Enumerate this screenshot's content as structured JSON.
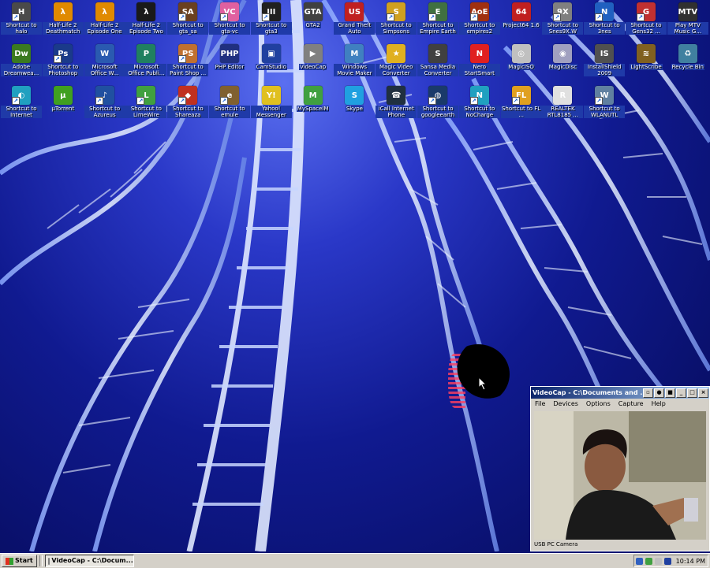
{
  "desktop": {
    "icons": [
      {
        "label": "Shortcut to halo",
        "icon": "halo-icon",
        "color": "#4a4a4a",
        "glyph": "H",
        "shortcut": true
      },
      {
        "label": "Half-Life 2 Deathmatch",
        "icon": "half-life-icon",
        "color": "#e08a00",
        "glyph": "λ",
        "shortcut": false
      },
      {
        "label": "Half-Life 2 Episode One",
        "icon": "half-life-icon",
        "color": "#e08a00",
        "glyph": "λ",
        "shortcut": false
      },
      {
        "label": "Half-Life 2 Episode Two",
        "icon": "half-life-icon",
        "color": "#1a1a1a",
        "glyph": "λ",
        "shortcut": false
      },
      {
        "label": "Shortcut to gta_sa",
        "icon": "gta-sa-icon",
        "color": "#6a4020",
        "glyph": "SA",
        "shortcut": true
      },
      {
        "label": "Shortcut to gta-vc",
        "icon": "gta-vc-icon",
        "color": "#e060a0",
        "glyph": "VC",
        "shortcut": true
      },
      {
        "label": "Shortcut to gta3",
        "icon": "gta3-icon",
        "color": "#202020",
        "glyph": "III",
        "shortcut": true
      },
      {
        "label": "GTA2",
        "icon": "gta2-icon",
        "color": "#404040",
        "glyph": "GTA",
        "shortcut": false
      },
      {
        "label": "Grand Theft Auto",
        "icon": "gta-flag-icon",
        "color": "#c02020",
        "glyph": "US",
        "shortcut": false
      },
      {
        "label": "Shortcut to Simpsons",
        "icon": "simpsons-icon",
        "color": "#d0a020",
        "glyph": "S",
        "shortcut": true
      },
      {
        "label": "Shortcut to Empire Earth",
        "icon": "empire-earth-icon",
        "color": "#407040",
        "glyph": "E",
        "shortcut": true
      },
      {
        "label": "Shortcut to empires2",
        "icon": "empires2-icon",
        "color": "#a03010",
        "glyph": "AoE",
        "shortcut": true
      },
      {
        "label": "Project64 1.6",
        "icon": "project64-icon",
        "color": "#c02020",
        "glyph": "64",
        "shortcut": false
      },
      {
        "label": "Shortcut to Snes9X.W",
        "icon": "snes9x-icon",
        "color": "#808080",
        "glyph": "9X",
        "shortcut": true
      },
      {
        "label": "Shortcut to 3nes",
        "icon": "nes-icon",
        "color": "#2060c0",
        "glyph": "N",
        "shortcut": true
      },
      {
        "label": "Shortcut to Gens32 ...",
        "icon": "gens-icon",
        "color": "#c03030",
        "glyph": "G",
        "shortcut": true
      },
      {
        "label": "Play MTV Music G...",
        "icon": "mtv-icon",
        "color": "#303030",
        "glyph": "MTV",
        "shortcut": false
      },
      {
        "label": "Adobe Dreamwea...",
        "icon": "dreamweaver-icon",
        "color": "#3a7a20",
        "glyph": "Dw",
        "shortcut": false
      },
      {
        "label": "Shortcut to Photoshop",
        "icon": "photoshop-icon",
        "color": "#1a3a8a",
        "glyph": "Ps",
        "shortcut": true
      },
      {
        "label": "Microsoft Office W...",
        "icon": "word-icon",
        "color": "#2a5ab0",
        "glyph": "W",
        "shortcut": false
      },
      {
        "label": "Microsoft Office Publi...",
        "icon": "publisher-icon",
        "color": "#208060",
        "glyph": "P",
        "shortcut": false
      },
      {
        "label": "Shortcut to Paint Shop ...",
        "icon": "paintshop-icon",
        "color": "#c07030",
        "glyph": "PS",
        "shortcut": true
      },
      {
        "label": "PHP Editor",
        "icon": "php-icon",
        "color": "#203080",
        "glyph": "PHP",
        "shortcut": false
      },
      {
        "label": "CamStudio",
        "icon": "camstudio-icon",
        "color": "#2040a0",
        "glyph": "▣",
        "shortcut": false
      },
      {
        "label": "VideoCap",
        "icon": "videocap-icon",
        "color": "#808080",
        "glyph": "▶",
        "shortcut": false
      },
      {
        "label": "Windows Movie Maker",
        "icon": "movie-maker-icon",
        "color": "#4080c0",
        "glyph": "M",
        "shortcut": false
      },
      {
        "label": "Magic Video Converter",
        "icon": "magic-video-icon",
        "color": "#e0b020",
        "glyph": "★",
        "shortcut": false
      },
      {
        "label": "Sansa Media Converter",
        "icon": "sansa-icon",
        "color": "#404040",
        "glyph": "S",
        "shortcut": false
      },
      {
        "label": "Nero StartSmart",
        "icon": "nero-icon",
        "color": "#e02020",
        "glyph": "N",
        "shortcut": false
      },
      {
        "label": "MagicISO",
        "icon": "magiciso-icon",
        "color": "#c0c0c0",
        "glyph": "◎",
        "shortcut": false
      },
      {
        "label": "MagicDisc",
        "icon": "magicdisc-icon",
        "color": "#a0a0c0",
        "glyph": "◉",
        "shortcut": false
      },
      {
        "label": "InstallShield 2009",
        "icon": "installshield-icon",
        "color": "#505050",
        "glyph": "IS",
        "shortcut": false
      },
      {
        "label": "LightScribe",
        "icon": "lightscribe-icon",
        "color": "#806020",
        "glyph": "≋",
        "shortcut": false
      },
      {
        "label": "Recycle Bin",
        "icon": "recycle-bin-icon",
        "color": "#4080a0",
        "glyph": "♻",
        "shortcut": false
      },
      {
        "label": "Shortcut to Internet",
        "icon": "internet-icon",
        "color": "#20a0c0",
        "glyph": "◐",
        "shortcut": true
      },
      {
        "label": "µTorrent",
        "icon": "utorrent-icon",
        "color": "#40a020",
        "glyph": "µ",
        "shortcut": false
      },
      {
        "label": "Shortcut to Azureus",
        "icon": "azureus-icon",
        "color": "#2050a0",
        "glyph": "♪",
        "shortcut": true
      },
      {
        "label": "Shortcut to LimeWire",
        "icon": "limewire-icon",
        "color": "#40a040",
        "glyph": "L",
        "shortcut": true
      },
      {
        "label": "Shortcut to Shareaza",
        "icon": "shareaza-icon",
        "color": "#c03020",
        "glyph": "◆",
        "shortcut": true
      },
      {
        "label": "Shortcut to emule",
        "icon": "emule-icon",
        "color": "#806030",
        "glyph": "e",
        "shortcut": true
      },
      {
        "label": "Yahoo! Messenger",
        "icon": "yahoo-messenger-icon",
        "color": "#e0c020",
        "glyph": "Y!",
        "shortcut": false
      },
      {
        "label": "MySpaceIM",
        "icon": "myspace-icon",
        "color": "#40a040",
        "glyph": "M",
        "shortcut": false
      },
      {
        "label": "Skype",
        "icon": "skype-icon",
        "color": "#20a0e0",
        "glyph": "S",
        "shortcut": false
      },
      {
        "label": "iCall Internet Phone",
        "icon": "icall-icon",
        "color": "#203040",
        "glyph": "☎",
        "shortcut": false
      },
      {
        "label": "Shortcut to googleearth",
        "icon": "google-earth-icon",
        "color": "#1a3a6a",
        "glyph": "◍",
        "shortcut": true
      },
      {
        "label": "Shortcut to NoCharge",
        "icon": "nocharge-icon",
        "color": "#20a0c0",
        "glyph": "N",
        "shortcut": true
      },
      {
        "label": "Shortcut to FL ...",
        "icon": "fl-studio-icon",
        "color": "#e0a020",
        "glyph": "FL",
        "shortcut": true
      },
      {
        "label": "REALTEK RTL8185 ...",
        "icon": "realtek-icon",
        "color": "#e0e0e0",
        "glyph": "R",
        "shortcut": false
      },
      {
        "label": "Shortcut to WLANUTL",
        "icon": "wlan-icon",
        "color": "#6080a0",
        "glyph": "W",
        "shortcut": true
      }
    ]
  },
  "videocap": {
    "title": "VideoCap - C:\\Documents and ...",
    "menu": [
      "File",
      "Devices",
      "Options",
      "Capture",
      "Help"
    ],
    "status": "USB PC Camera"
  },
  "taskbar": {
    "start_label": "Start",
    "task_label": "VideoCap - C:\\Docum...",
    "clock": "10:14 PM"
  }
}
